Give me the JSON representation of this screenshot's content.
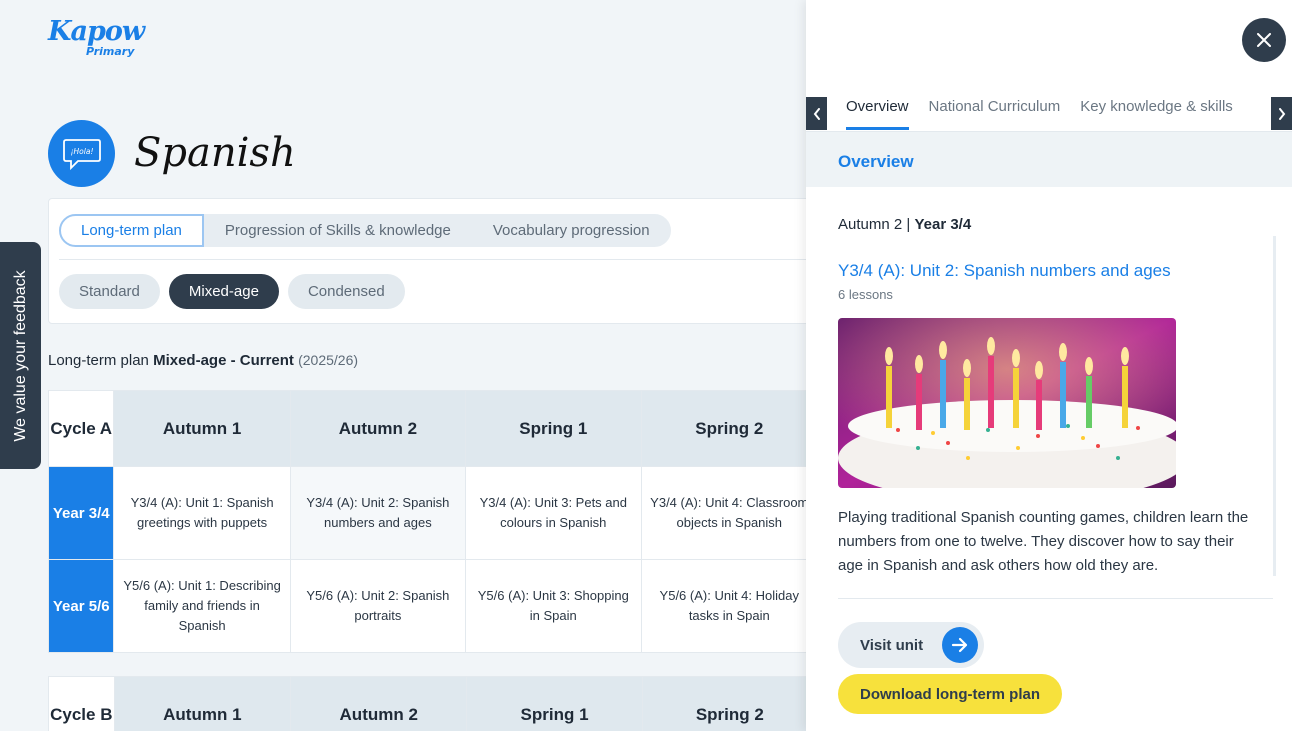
{
  "brand": {
    "logo_main": "Kapow",
    "logo_sub": "Primary"
  },
  "subject": {
    "title": "Spanish",
    "icon_text": "¡Hola!"
  },
  "plan_tabs": [
    "Long-term plan",
    "Progression of Skills & knowledge",
    "Vocabulary progression"
  ],
  "plan_pills": [
    "Standard",
    "Mixed-age",
    "Condensed"
  ],
  "caption": {
    "prefix": "Long-term plan",
    "bold": "Mixed-age - Current",
    "year": "(2025/26)"
  },
  "feedback_label": "We value your feedback",
  "cycle_a": {
    "label": "Cycle A",
    "terms": [
      "Autumn 1",
      "Autumn 2",
      "Spring 1",
      "Spring 2"
    ],
    "rows": [
      {
        "year": "Year 3/4",
        "cells": [
          "Y3/4 (A): Unit 1: Spanish greetings with puppets",
          "Y3/4 (A): Unit 2: Spanish numbers and ages",
          "Y3/4 (A): Unit 3: Pets and colours in Spanish",
          "Y3/4 (A): Unit 4: Classroom objects in Spanish"
        ]
      },
      {
        "year": "Year 5/6",
        "cells": [
          "Y5/6 (A): Unit 1: Describing family and friends in Spanish",
          "Y5/6 (A): Unit 2: Spanish portraits",
          "Y5/6 (A): Unit 3: Shopping in Spain",
          "Y5/6 (A): Unit 4: Holiday tasks in Spain"
        ]
      }
    ]
  },
  "cycle_b": {
    "label": "Cycle B",
    "terms": [
      "Autumn 1",
      "Autumn 2",
      "Spring 1",
      "Spring 2"
    ]
  },
  "panel": {
    "tabs": [
      "Overview",
      "National Curriculum",
      "Key knowledge & skills"
    ],
    "section_title": "Overview",
    "term": "Autumn 2 |",
    "year": "Year 3/4",
    "unit_title": "Y3/4 (A): Unit 2: Spanish numbers and ages",
    "lessons": "6 lessons",
    "description": "Playing traditional Spanish counting games, children learn the numbers from one to twelve. They discover how to say their age in Spanish and ask others how old they are.",
    "visit_label": "Visit unit",
    "download_label": "Download long-term plan"
  },
  "colors": {
    "accent": "#1a7fe6",
    "dark": "#2f3d4c",
    "yellow": "#f7e13c"
  }
}
